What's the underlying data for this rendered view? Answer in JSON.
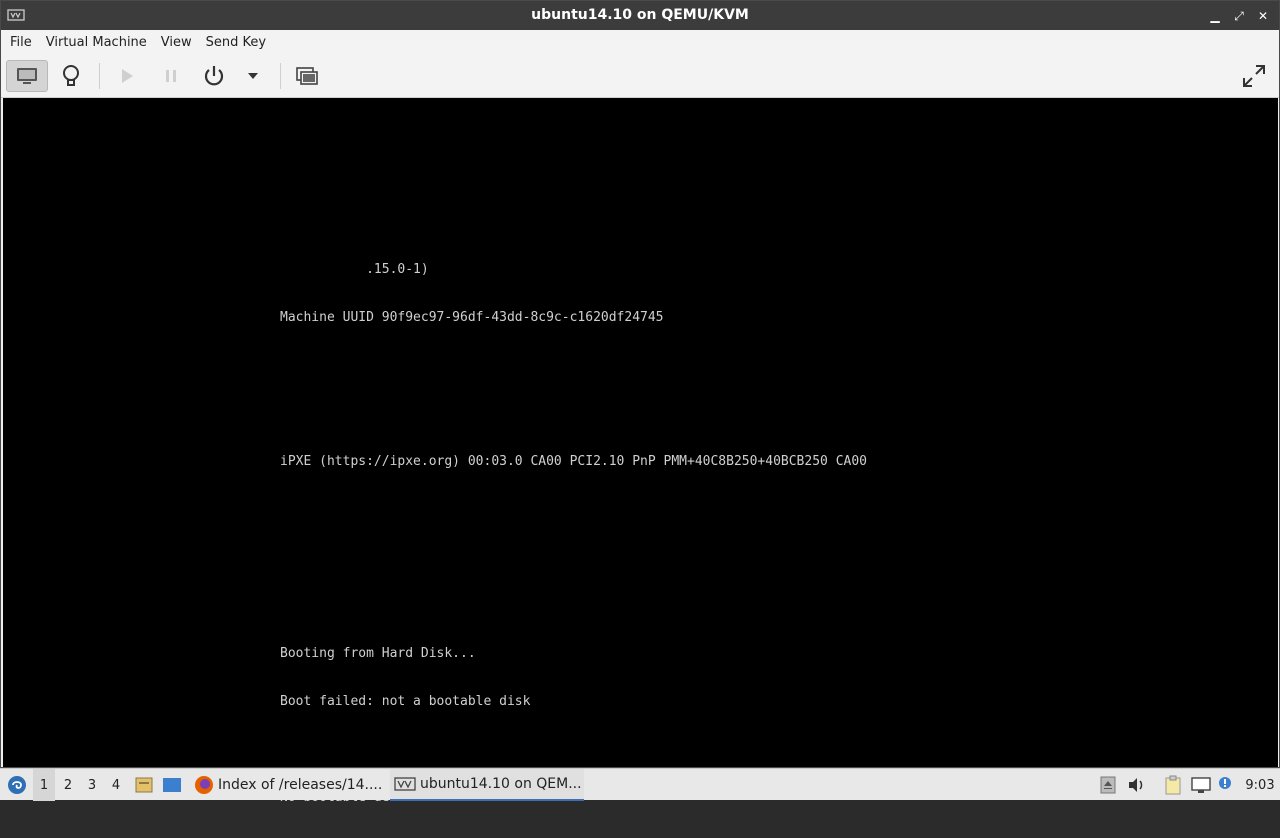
{
  "window": {
    "title": "ubuntu14.10 on QEMU/KVM",
    "minimize": "▁",
    "maximize": "⤢",
    "close": "✕"
  },
  "menubar": {
    "items": [
      "File",
      "Virtual Machine",
      "View",
      "Send Key"
    ]
  },
  "toolbar": {
    "buttons": [
      "console-icon",
      "details-lightbulb-icon",
      "run-icon",
      "pause-icon",
      "power-icon",
      "power-menu-dropdown-icon",
      "snapshots-icon",
      "fullscreen-icon"
    ]
  },
  "console": {
    "lines": [
      "           .15.0-1)",
      "Machine UUID 90f9ec97-96df-43dd-8c9c-c1620df24745",
      "",
      "",
      "iPXE (https://ipxe.org) 00:03.0 CA00 PCI2.10 PnP PMM+40C8B250+40BCB250 CA00",
      "",
      "",
      "",
      "Booting from Hard Disk...",
      "Boot failed: not a bootable disk",
      "",
      "No bootable device."
    ]
  },
  "taskbar": {
    "workspaces": [
      "1",
      "2",
      "3",
      "4"
    ],
    "active_workspace": "1",
    "tasks": [
      {
        "label": "Index of /releases/14....",
        "icon": "firefox-icon"
      },
      {
        "label": "ubuntu14.10 on QEM...",
        "icon": "virt-manager-icon"
      }
    ],
    "clock": "9:03"
  },
  "colors": {
    "titlebar": "#3c3c3c",
    "console_bg": "#000000",
    "console_text": "#d0d0d0",
    "taskbar_active": "#3c6fb4"
  }
}
